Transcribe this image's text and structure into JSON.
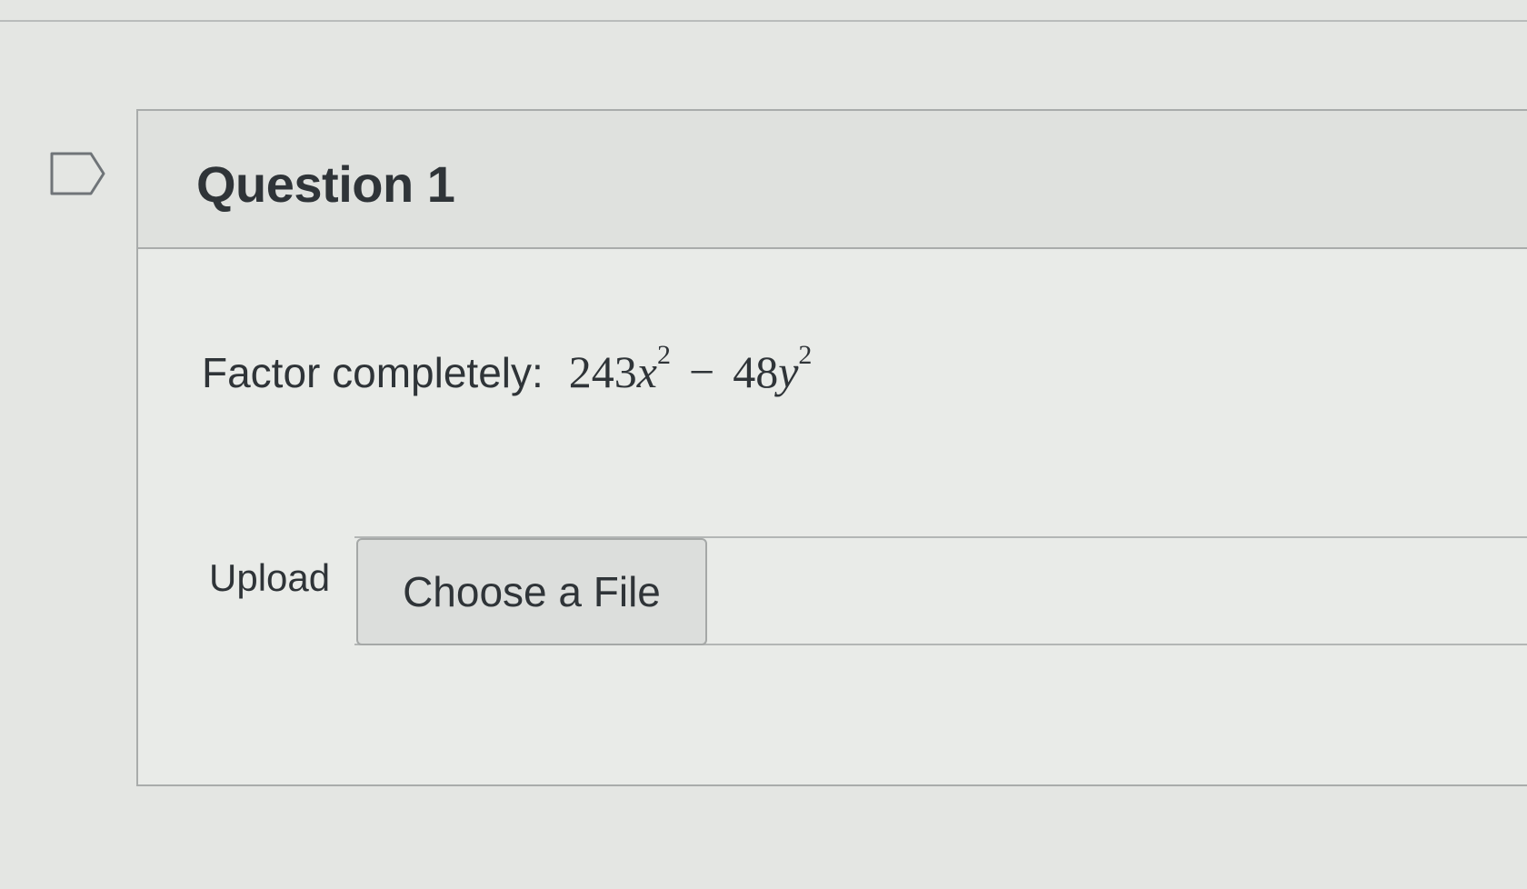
{
  "question": {
    "title": "Question 1",
    "prompt_label": "Factor completely:",
    "expression": {
      "coef1": "243",
      "var1": "x",
      "exp1": "2",
      "operator": "−",
      "coef2": "48",
      "var2": "y",
      "exp2": "2"
    }
  },
  "upload": {
    "label": "Upload",
    "button_label": "Choose a File"
  },
  "icons": {
    "flag": "flag-icon"
  }
}
